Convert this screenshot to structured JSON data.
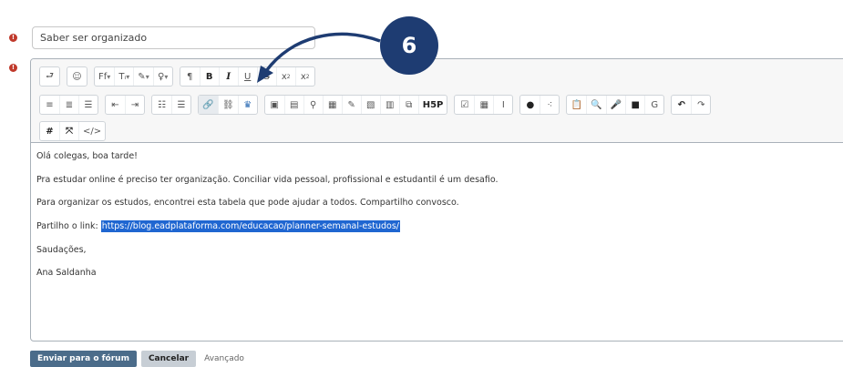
{
  "form": {
    "subject_value": "Saber ser organizado",
    "required_mark": "!"
  },
  "toolbar": {
    "row1": [
      {
        "name": "collapse-button",
        "label": "⮐",
        "dd": false
      },
      {
        "name": "emoji-button",
        "label": "☺",
        "dd": false
      },
      {
        "name": "font-family-button",
        "label": "Ff",
        "dd": true
      },
      {
        "name": "font-size-button",
        "label": "Tᵢ",
        "dd": true
      },
      {
        "name": "text-color-button",
        "label": "✎",
        "dd": true
      },
      {
        "name": "highlight-button",
        "label": "♀",
        "dd": true
      },
      {
        "name": "paragraph-style-button",
        "label": "¶",
        "dd": false
      },
      {
        "name": "bold-button",
        "label": "B",
        "dd": false
      },
      {
        "name": "italic-button",
        "label": "I",
        "dd": false
      },
      {
        "name": "underline-button",
        "label": "U",
        "dd": false
      },
      {
        "name": "strikethrough-button",
        "label": "S",
        "dd": false
      },
      {
        "name": "subscript-button",
        "label": "x",
        "dd": false,
        "sub": "2"
      },
      {
        "name": "superscript-button",
        "label": "x",
        "dd": false,
        "sup": "2"
      }
    ],
    "row2": [
      "≡",
      "≣",
      "☰",
      "⇤",
      "⇥",
      "☷",
      "☰",
      "🔗",
      "⛓",
      "♛",
      "▣",
      "▤",
      "⚲",
      "▦",
      "✎",
      "▧",
      "▥",
      "⧉",
      "H5P",
      "☑",
      "▦",
      "Ⅰ",
      "●",
      "⁖",
      "📋",
      "🔍",
      "🎤",
      "■",
      "G",
      "↶",
      "↷"
    ],
    "row3": [
      "#",
      "⤧",
      "</>"
    ]
  },
  "content": {
    "lines": [
      "Olá colegas, boa tarde!",
      "Pra estudar online é preciso ter organização. Conciliar vida pessoal, profissional e estudantil é um desafio.",
      "Para organizar os estudos, encontrei esta tabela que pode ajudar a todos. Compartilho convosco.",
      "",
      "Saudações,",
      "Ana Saldanha"
    ],
    "link_prefix": "Partilho o link: ",
    "link_text": "https://blog.eadplataforma.com/educacao/planner-semanal-estudos/"
  },
  "actions": {
    "submit_label": "Enviar para o fórum",
    "cancel_label": "Cancelar",
    "advanced_label": "Avançado"
  },
  "callout": {
    "number": "6",
    "color": "#1e3c72"
  }
}
